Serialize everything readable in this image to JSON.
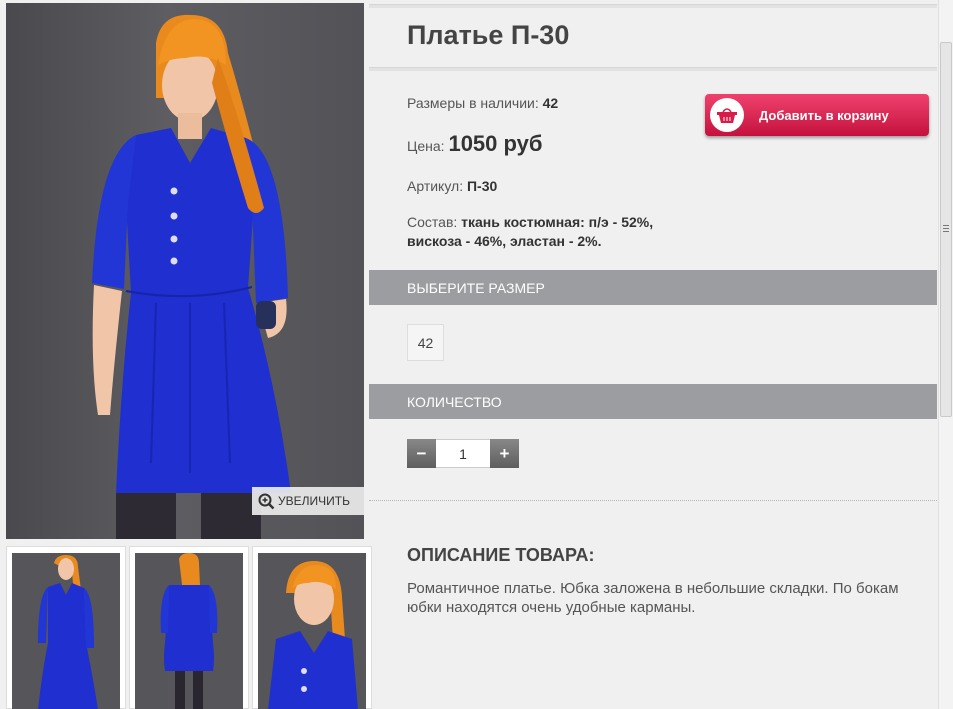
{
  "product": {
    "title": "Платье П-30",
    "sizes_label": "Размеры в наличии:",
    "sizes_value": "42",
    "price_label": "Цена:",
    "price_value": "1050 руб",
    "article_label": "Артикул:",
    "article_value": "П-30",
    "composition_label": "Состав:",
    "composition_value": "ткань костюмная: п/э - 52%, вискоза - 46%, эластан - 2%."
  },
  "cart_button": {
    "label": "Добавить в корзину",
    "icon": "basket-icon"
  },
  "size_section": {
    "header": "ВЫБЕРИТЕ РАЗМЕР",
    "options": [
      "42"
    ]
  },
  "quantity_section": {
    "header": "КОЛИЧЕСТВО",
    "value": "1",
    "minus": "−",
    "plus": "+"
  },
  "gallery": {
    "zoom_label": "УВЕЛИЧИТЬ",
    "thumbnail_count": 3
  },
  "description": {
    "title": "ОПИСАНИЕ ТОВАРА:",
    "text": "Романтичное платье. Юбка заложена в небольшие складки. По бокам юбки находятся очень удобные карманы."
  },
  "colors": {
    "dress_blue": "#1f2fd0",
    "hair": "#e98a1e",
    "cart_red": "#d81b48",
    "section_bar": "#9b9da0"
  }
}
